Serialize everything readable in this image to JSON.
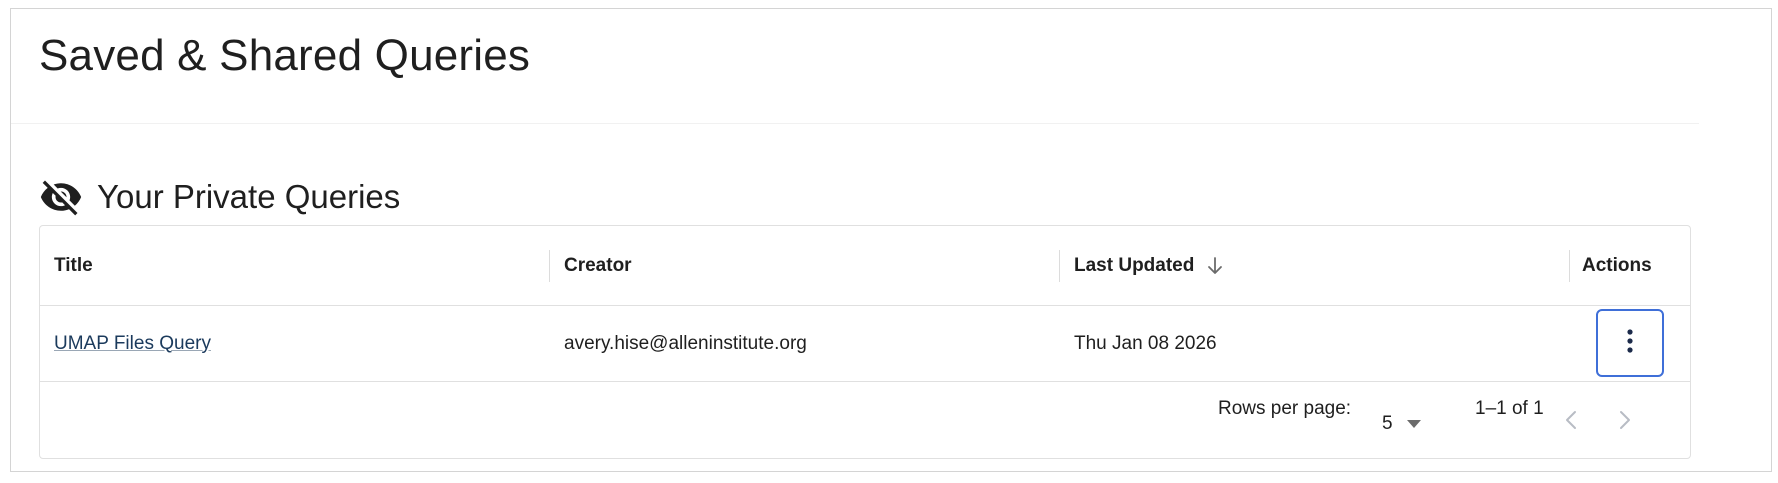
{
  "page": {
    "title": "Saved & Shared Queries"
  },
  "section": {
    "title": "Your Private Queries",
    "icon": "eye-off-icon"
  },
  "table": {
    "columns": {
      "title": "Title",
      "creator": "Creator",
      "last_updated": "Last Updated",
      "actions": "Actions"
    },
    "sort": {
      "column": "last_updated",
      "direction": "descending",
      "icon": "arrow-down-icon"
    },
    "rows": [
      {
        "title": "UMAP Files Query",
        "creator": "avery.hise@alleninstitute.org",
        "last_updated": "Thu Jan 08 2026",
        "actions_icon": "more-vertical-icon"
      }
    ]
  },
  "pagination": {
    "rows_per_page_label": "Rows per page:",
    "rows_per_page_value": "5",
    "range_text": "1–1 of 1",
    "prev_enabled": false,
    "next_enabled": false
  },
  "colors": {
    "accent_border": "#3f6fd8",
    "link": "#1b3a5c",
    "text": "#1f1f1f",
    "disabled": "#b8bcc4",
    "divider": "#e0e0e0"
  }
}
